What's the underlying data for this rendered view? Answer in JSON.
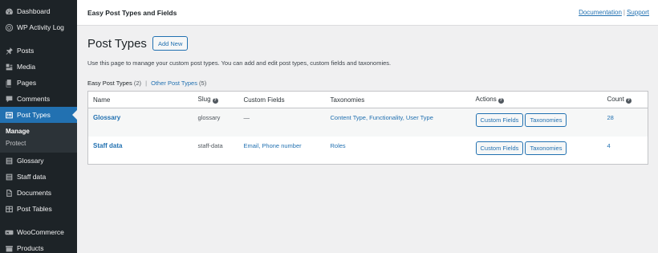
{
  "sidebar": {
    "items": [
      {
        "label": "Dashboard",
        "icon": "dashboard-icon"
      },
      {
        "label": "WP Activity Log",
        "icon": "activity-log-icon"
      },
      {
        "label": "Posts",
        "icon": "pushpin-icon"
      },
      {
        "label": "Media",
        "icon": "media-icon"
      },
      {
        "label": "Pages",
        "icon": "pages-icon"
      },
      {
        "label": "Comments",
        "icon": "comments-icon"
      },
      {
        "label": "Post Types",
        "icon": "post-types-icon"
      },
      {
        "label": "Glossary",
        "icon": "list-icon"
      },
      {
        "label": "Staff data",
        "icon": "list-icon"
      },
      {
        "label": "Documents",
        "icon": "document-icon"
      },
      {
        "label": "Post Tables",
        "icon": "table-icon"
      },
      {
        "label": "WooCommerce",
        "icon": "woocommerce-icon"
      },
      {
        "label": "Products",
        "icon": "products-icon"
      }
    ],
    "submenu": [
      "Manage",
      "Protect"
    ],
    "active_color": "#2271b1"
  },
  "topbar": {
    "title": "Easy Post Types and Fields",
    "documentation": "Documentation",
    "separator": "|",
    "support": "Support"
  },
  "main": {
    "title": "Post Types",
    "add_new": "Add New",
    "description": "Use this page to manage your custom post types. You can add and edit post types, custom fields and taxonomies.",
    "filters": {
      "current_label": "Easy Post Types",
      "current_count": "(2)",
      "separator": "|",
      "other_label": "Other Post Types",
      "other_count": "(5)"
    },
    "table": {
      "columns": [
        "Name",
        "Slug",
        "Custom Fields",
        "Taxonomies",
        "Actions",
        "Count"
      ],
      "rows": [
        {
          "name": "Glossary",
          "slug": "glossary",
          "custom_fields": "—",
          "taxonomies": "Content Type, Functionality, User Type",
          "btn_fields": "Custom Fields",
          "btn_tax": "Taxonomies",
          "count": "28"
        },
        {
          "name": "Staff data",
          "slug": "staff-data",
          "custom_fields": "Email, Phone number",
          "taxonomies": "Roles",
          "btn_fields": "Custom Fields",
          "btn_tax": "Taxonomies",
          "count": "4"
        }
      ]
    },
    "help_glyph": "?"
  }
}
